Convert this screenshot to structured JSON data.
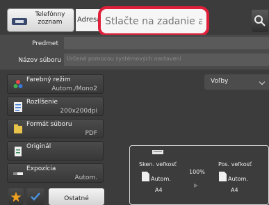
{
  "header": {
    "phonebook_label": "Telefónny zoznam",
    "address_label": "Adresa",
    "address_placeholder": "Stlačte na zadanie adresy"
  },
  "form": {
    "subject_label": "Predmet",
    "filename_label": "Názov súboru",
    "filename_placeholder": "Určené pomocou systémových nastavení"
  },
  "settings": [
    {
      "title": "Farebný režim",
      "value": "Autom./Mono2"
    },
    {
      "title": "Rozlíšenie",
      "value": "200x200dpi"
    },
    {
      "title": "Formát súboru",
      "value": "PDF"
    },
    {
      "title": "Originál",
      "value": ""
    },
    {
      "title": "Expozícia",
      "value": "Autom."
    }
  ],
  "options_label": "Voľby",
  "preview": {
    "scan_size_label": "Sken. veľkosť",
    "scan_size_value": "Autom.",
    "scan_paper": "A4",
    "ratio": "100%",
    "send_size_label": "Pos. veľkosť",
    "send_size_value": "Autom.",
    "send_paper": "A4"
  },
  "footer": {
    "other_label": "Ostatné"
  },
  "colors": {
    "highlight": "#e0203a",
    "star": "#f0a020",
    "check": "#4a90d9"
  }
}
